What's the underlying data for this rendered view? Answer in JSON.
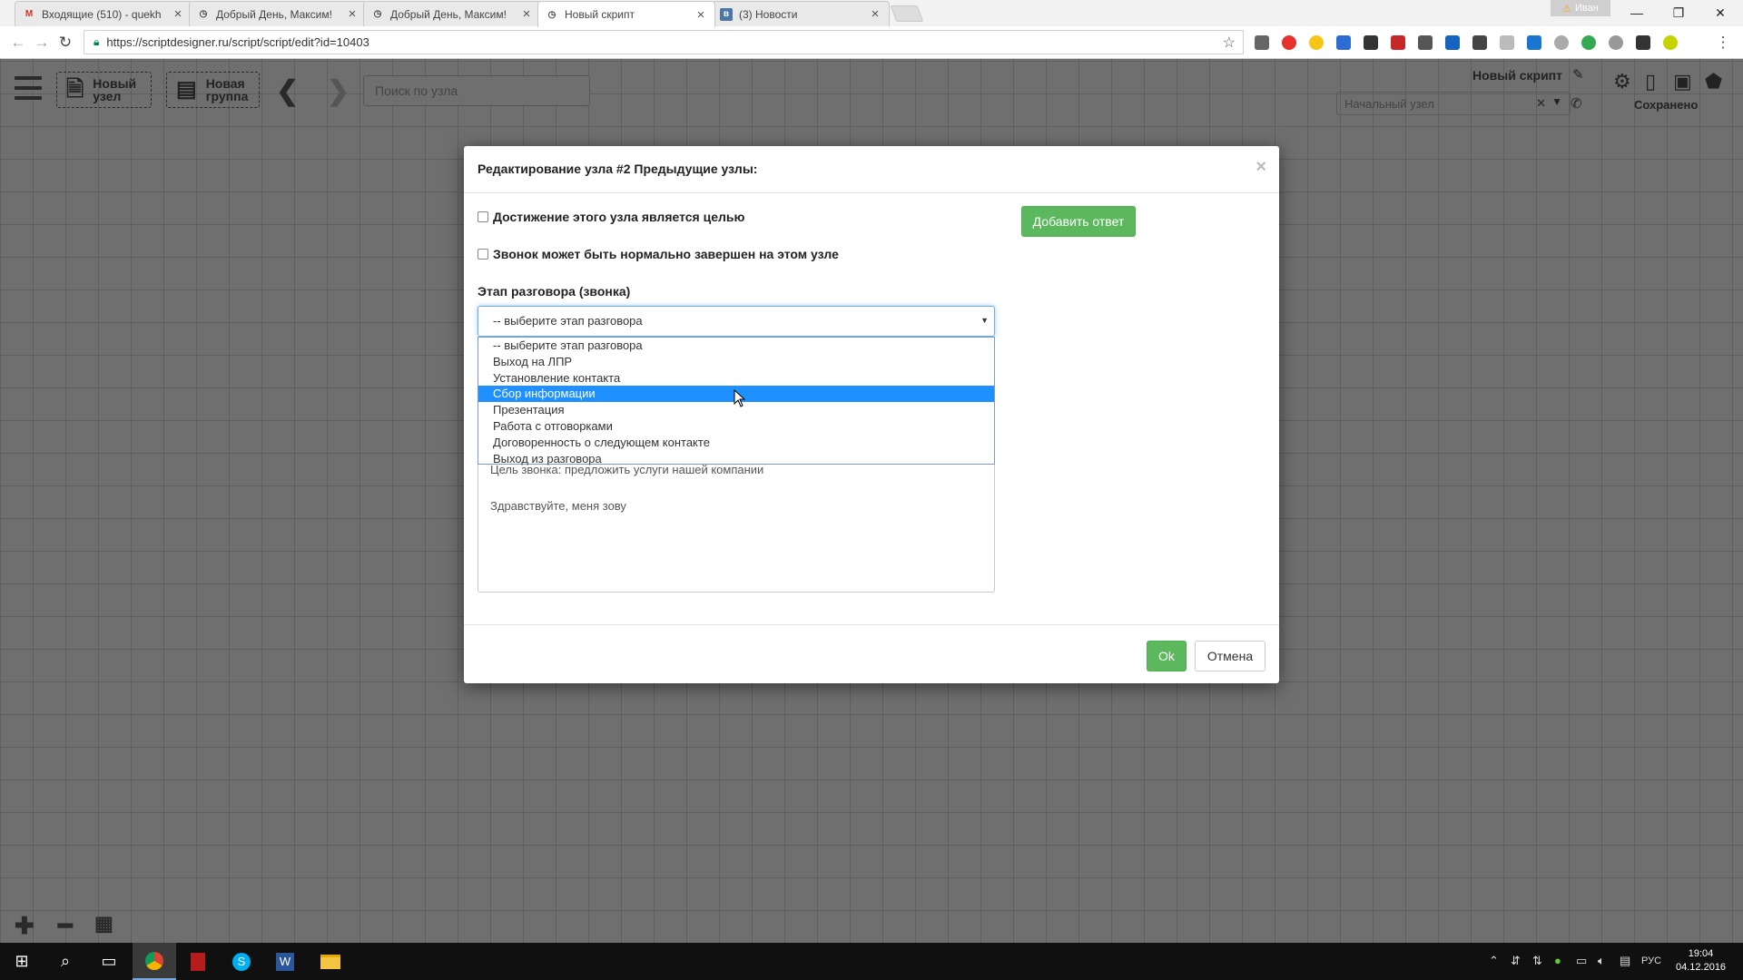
{
  "browser": {
    "tabs": [
      {
        "title": "Входящие (510) - quekh",
        "icon": "gmail-icon",
        "active": false
      },
      {
        "title": "Добрый День, Максим!",
        "icon": "page-icon",
        "active": false
      },
      {
        "title": "Добрый День, Максим!",
        "icon": "page-icon",
        "active": false
      },
      {
        "title": "Новый скрипт",
        "icon": "page-icon",
        "active": true
      },
      {
        "title": "(3) Новости",
        "icon": "vk-icon",
        "active": false
      }
    ],
    "profile_name": "Иван",
    "url": "https://scriptdesigner.ru/script/script/edit?id=10403"
  },
  "app": {
    "new_node_label_1": "Новый",
    "new_node_label_2": "узел",
    "new_group_label_1": "Новая",
    "new_group_label_2": "группа",
    "search_placeholder": "Поиск по узла",
    "script_title": "Новый скрипт",
    "start_node_placeholder": "Начальный узел",
    "status": "Сохранено"
  },
  "modal": {
    "title": "Редактирование узла #2 Предыдущие узлы:",
    "checkbox_goal": "Достижение этого узла является целью",
    "checkbox_end": "Звонок может быть нормально завершен на этом узле",
    "add_answer_button": "Добавить ответ",
    "stage_label": "Этап разговора (звонка)",
    "stage_selected": "-- выберите этап разговора",
    "stage_options": [
      "-- выберите этап разговора",
      "Выход на ЛПР",
      "Установление контакта",
      "Сбор информации",
      "Презентация",
      "Работа с отговорками",
      "Договоренность о следующем контакте",
      "Выход из разговора"
    ],
    "highlighted_option_index": 3,
    "text_line_partial": "Цель звонка: предложить услуги нашей компании",
    "text_line_2": "Здравствуйте, меня зову",
    "ok_button": "Ok",
    "cancel_button": "Отмена"
  },
  "taskbar": {
    "language": "РУС",
    "time": "19:04",
    "date": "04.12.2016"
  },
  "colors": {
    "primary_green": "#5cb85c",
    "option_highlight": "#1e90ff",
    "canvas_bg": "#6f6f6f"
  }
}
